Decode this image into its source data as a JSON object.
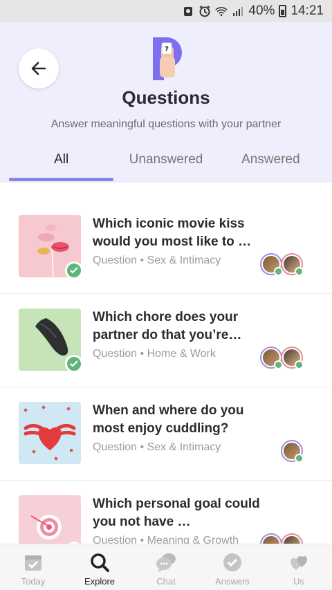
{
  "status_bar": {
    "battery": "40%",
    "time": "14:21"
  },
  "header": {
    "title": "Questions",
    "subtitle": "Answer meaningful questions with your partner",
    "tabs": [
      {
        "label": "All",
        "active": true
      },
      {
        "label": "Unanswered",
        "active": false
      },
      {
        "label": "Answered",
        "active": false
      }
    ]
  },
  "questions": [
    {
      "title": "Which iconic movie kiss would you most like to …",
      "type": "Question",
      "category": "Sex & Intimacy",
      "answered_by_you": true,
      "partner_answered": true,
      "thumb_icon": "lips-balloons"
    },
    {
      "title": "Which chore does your partner do that you’re…",
      "type": "Question",
      "category": "Home & Work",
      "answered_by_you": true,
      "partner_answered": true,
      "thumb_icon": "rubber-glove"
    },
    {
      "title": "When and where do you most enjoy cuddling?",
      "type": "Question",
      "category": "Sex & Intimacy",
      "answered_by_you": false,
      "partner_answered": true,
      "thumb_icon": "heart-with-wings"
    },
    {
      "title": "Which personal goal could you not have …",
      "type": "Question",
      "category": "Meaning & Growth",
      "answered_by_you": true,
      "partner_answered": true,
      "thumb_icon": "target"
    }
  ],
  "meta_separator": "•",
  "bottom_nav": [
    {
      "label": "Today",
      "icon": "calendar-check-icon",
      "active": false
    },
    {
      "label": "Explore",
      "icon": "search-icon",
      "active": true
    },
    {
      "label": "Chat",
      "icon": "chat-bubbles-icon",
      "active": false
    },
    {
      "label": "Answers",
      "icon": "check-circle-icon",
      "active": false
    },
    {
      "label": "Us",
      "icon": "hearts-icon",
      "active": false
    }
  ],
  "colors": {
    "header_bg": "#eeeefc",
    "accent": "#8a84e8",
    "check": "#5fb57a"
  }
}
